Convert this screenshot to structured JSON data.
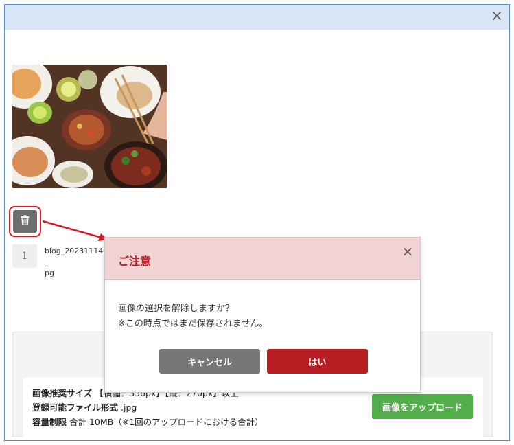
{
  "modal": {
    "close_symbol": "×"
  },
  "image_item": {
    "index": "1",
    "file_name": "blog_20231114_\npg",
    "thumbnail_icon": "food-photo-image",
    "delete_icon": "trash-icon"
  },
  "requirements": {
    "size_label": "画像推奨サイズ",
    "size_value": "【横幅：336px】【縦：270px】以上",
    "format_label": "登録可能ファイル形式",
    "format_value": ".jpg",
    "limit_label": "容量制限",
    "limit_value": "合計 10MB（※1回のアップロードにおける合計）",
    "upload_label": "画像をアップロード"
  },
  "dialog": {
    "title": "ご注意",
    "close_symbol": "×",
    "message_line1": "画像の選択を解除しますか？",
    "message_line2": "※この時点ではまだ保存されません。",
    "cancel_label": "キャンセル",
    "yes_label": "はい"
  },
  "colors": {
    "header_bg": "#d9e6f6",
    "dialog_header_bg": "#f3d4d4",
    "dialog_title": "#b3202a",
    "cancel_button": "#777777",
    "yes_button": "#b71c23",
    "upload_button": "#53ad4b",
    "highlight": "#e0141e"
  }
}
